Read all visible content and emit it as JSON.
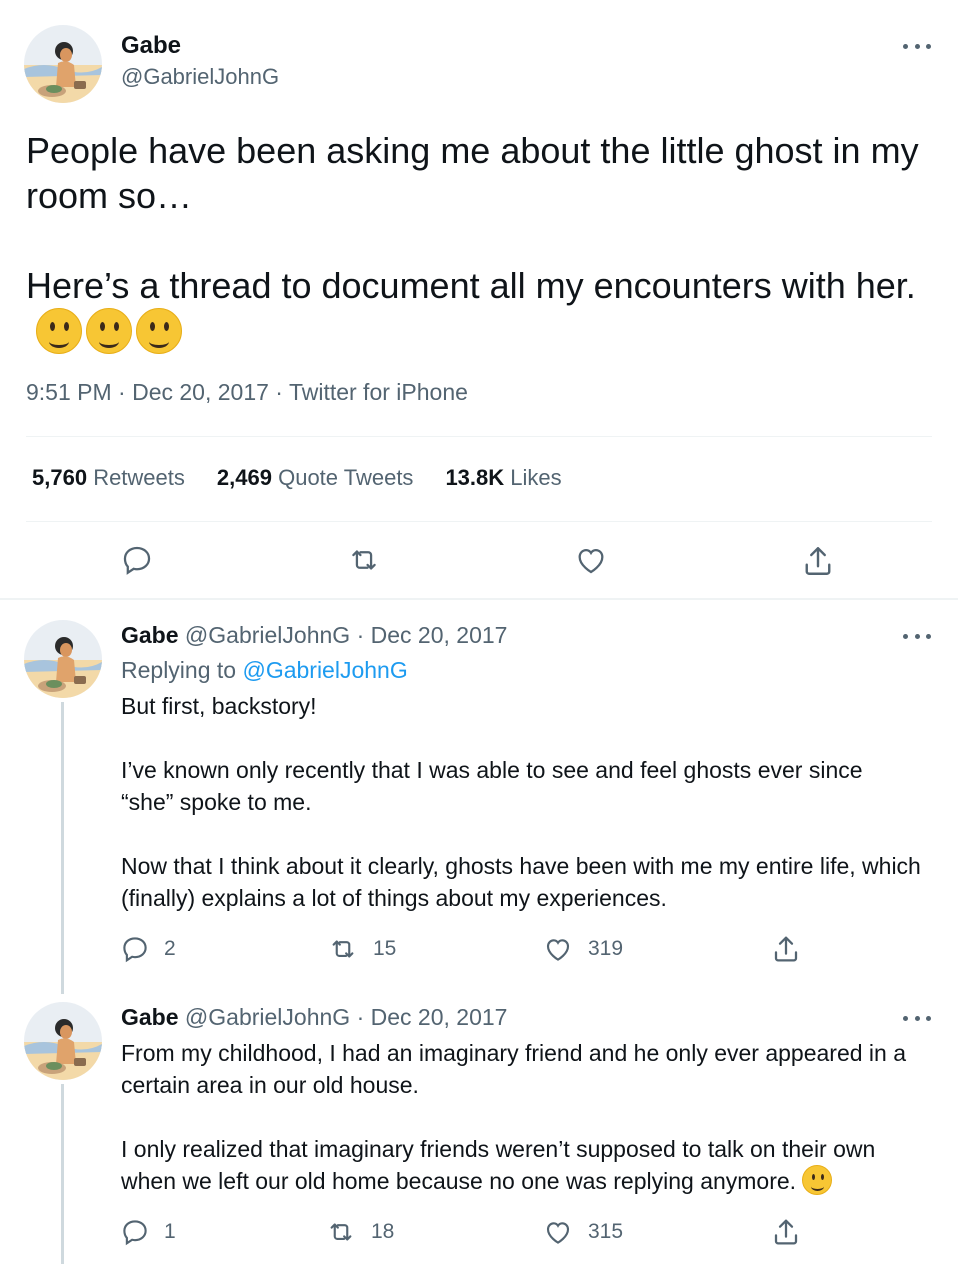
{
  "main_tweet": {
    "author_name": "Gabe",
    "author_handle": "@GabrielJohnG",
    "text": "People have been asking me about the little ghost in my room so…\n\nHere’s a thread to document all my encounters with her.",
    "text_emoji": "slightly-smiling-face x3",
    "meta": "9:51 PM · Dec 20, 2017 · Twitter for iPhone",
    "stats": {
      "retweets_count": "5,760",
      "retweets_label": "Retweets",
      "quotes_count": "2,469",
      "quotes_label": "Quote Tweets",
      "likes_count": "13.8K",
      "likes_label": "Likes"
    }
  },
  "replies": [
    {
      "author_name": "Gabe",
      "author_handle": "@GabrielJohnG",
      "separator": " · ",
      "date": "Dec 20, 2017",
      "replying_prefix": "Replying to ",
      "replying_to": "@GabrielJohnG",
      "text": "But first, backstory!\n\nI’ve known only recently that I was able to see and feel ghosts ever since “she” spoke to me.\n\nNow that I think about it clearly, ghosts have been with me my entire life, which (finally) explains a lot of things about my experiences.",
      "reply_count": "2",
      "retweet_count": "15",
      "like_count": "319"
    },
    {
      "author_name": "Gabe",
      "author_handle": "@GabrielJohnG",
      "separator": " · ",
      "date": "Dec 20, 2017",
      "text": "From my childhood, I had an imaginary friend and he only ever appeared in a certain area in our old house.\n\nI only realized that imaginary friends weren’t supposed to talk on their own when we left our old home because no one was replying anymore.",
      "text_emoji": "slightly-smiling-face",
      "reply_count": "1",
      "retweet_count": "18",
      "like_count": "315"
    }
  ],
  "icons": {
    "reply": "reply-icon",
    "retweet": "retweet-icon",
    "like": "heart-icon",
    "share": "share-icon",
    "more": "more-icon"
  },
  "colors": {
    "text": "#0f1419",
    "secondary": "#536471",
    "link": "#1d9bf0",
    "divider": "#eff3f4",
    "thread_line": "#cfd9de"
  }
}
